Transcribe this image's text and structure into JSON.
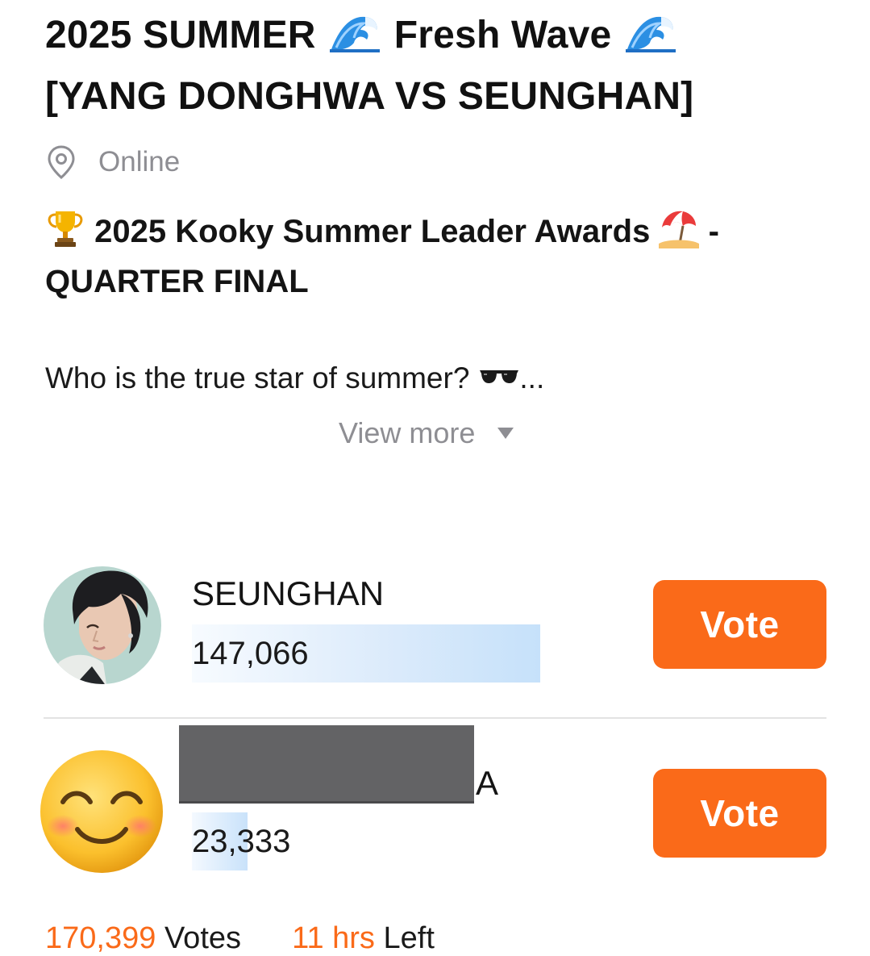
{
  "event": {
    "title_part1": "2025 SUMMER",
    "title_part2": "Fresh Wave",
    "title_line2": "[YANG DONGHWA VS SEUNGHAN]",
    "location": "Online",
    "subtitle_main": "2025 Kooky Summer Leader Awards",
    "subtitle_tail": " -",
    "subtitle_line2": "QUARTER FINAL",
    "description": "Who is the true star of summer?",
    "description_ellipsis": "...",
    "view_more": "View more"
  },
  "candidates": [
    {
      "name": "SEUNGHAN",
      "votes": "147,066",
      "vote_share": 0.863,
      "vote_label": "Vote",
      "avatar": "profile-photo"
    },
    {
      "name_visible": "A",
      "votes": "23,333",
      "vote_share": 0.137,
      "vote_label": "Vote",
      "avatar": "smiling-face-emoji"
    }
  ],
  "footer": {
    "total_votes": "170,399",
    "votes_label": "Votes",
    "time_left": "11 hrs",
    "time_left_label": "Left"
  },
  "colors": {
    "accent": "#fa6a19",
    "muted": "#8e8e93",
    "bar": "#c6e1fa"
  }
}
